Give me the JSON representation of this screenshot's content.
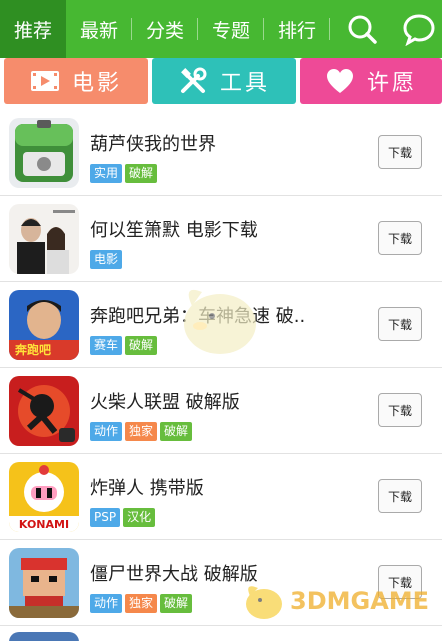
{
  "nav": {
    "tabs": [
      "推荐",
      "最新",
      "分类",
      "专题",
      "排行"
    ],
    "active_tab": "推荐",
    "search_icon": "search-icon",
    "chat_icon": "chat-icon",
    "bg_color": "#47b832",
    "active_bg_color": "#2f8f22"
  },
  "categories": {
    "movie": {
      "label": "电影",
      "icon": "film-icon",
      "color": "#f68c6c"
    },
    "tool": {
      "label": "工具",
      "icon": "tools-icon",
      "color": "#2ec1b8"
    },
    "wish": {
      "label": "许愿",
      "icon": "heart-icon",
      "color": "#ee4a97"
    }
  },
  "items": [
    {
      "title": "葫芦侠我的世界",
      "tags": [
        "实用",
        "破解"
      ],
      "download_label": "下载"
    },
    {
      "title": "何以笙箫默  电影下载",
      "tags": [
        "电影"
      ],
      "download_label": "下载"
    },
    {
      "title": "奔跑吧兄弟：车神急速  破..",
      "tags": [
        "赛车",
        "破解"
      ],
      "download_label": "下载"
    },
    {
      "title": "火柴人联盟  破解版",
      "tags": [
        "动作",
        "独家",
        "破解"
      ],
      "download_label": "下载"
    },
    {
      "title": "炸弹人  携带版",
      "tags": [
        "PSP",
        "汉化"
      ],
      "download_label": "下载",
      "thumb_text": "KONAMI"
    },
    {
      "title": "僵尸世界大战  破解版",
      "tags": [
        "动作",
        "独家",
        "破解"
      ],
      "download_label": "下载"
    }
  ],
  "watermark": {
    "text": "3DMGAME"
  }
}
